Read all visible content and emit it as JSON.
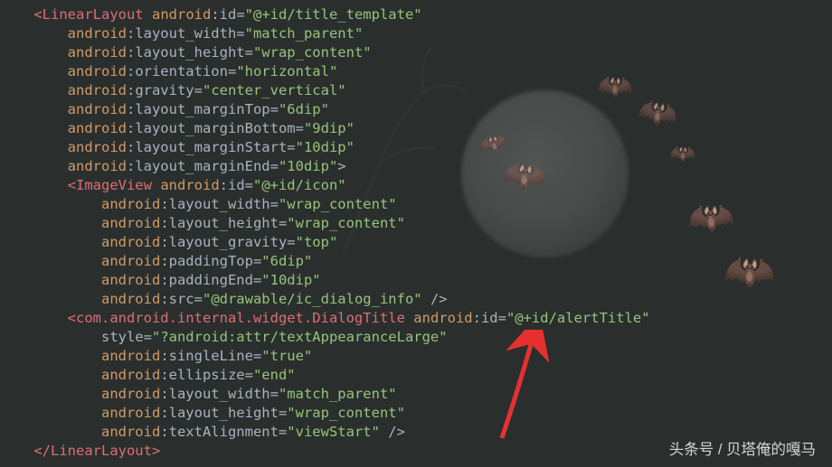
{
  "watermark": "头条号 / 贝塔俺的嘎马",
  "code": {
    "tags": {
      "LinearLayout_open": "<LinearLayout",
      "LinearLayout_close": "</LinearLayout>",
      "ImageView_open": "<ImageView",
      "DialogTitle_open": "<com.android.internal.widget.DialogTitle"
    },
    "ns": "android",
    "attrs": {
      "id": ":id=",
      "layout_width": ":layout_width=",
      "layout_height": ":layout_height=",
      "orientation": ":orientation=",
      "gravity": ":gravity=",
      "layout_marginTop": ":layout_marginTop=",
      "layout_marginBottom": ":layout_marginBottom=",
      "layout_marginStart": ":layout_marginStart=",
      "layout_marginEnd": ":layout_marginEnd=",
      "layout_gravity": ":layout_gravity=",
      "paddingTop": ":paddingTop=",
      "paddingEnd": ":paddingEnd=",
      "src": ":src=",
      "singleLine": ":singleLine=",
      "ellipsize": ":ellipsize=",
      "textAlignment": ":textAlignment=",
      "style": "style="
    },
    "vals": {
      "title_template": "\"@+id/title_template\"",
      "match_parent": "\"match_parent\"",
      "wrap_content": "\"wrap_content\"",
      "horizontal": "\"horizontal\"",
      "center_vertical": "\"center_vertical\"",
      "6dip": "\"6dip\"",
      "9dip": "\"9dip\"",
      "10dip": "\"10dip\"",
      "icon": "\"@+id/icon\"",
      "top": "\"top\"",
      "ic_dialog_info": "\"@drawable/ic_dialog_info\"",
      "alertTitle": "\"@+id/alertTitle\"",
      "textAppearanceLarge": "\"?android:attr/textAppearanceLarge\"",
      "true_v": "\"true\"",
      "end_v": "\"end\"",
      "viewStart": "\"viewStart\""
    },
    "punct": {
      "gt": ">",
      "selfclose": " />"
    }
  }
}
